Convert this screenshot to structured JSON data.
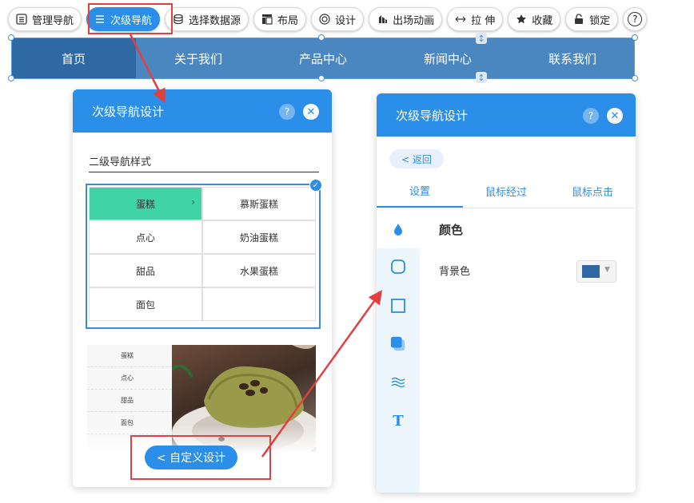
{
  "toolbar": {
    "items": [
      {
        "label": "管理导航",
        "icon": "list-icon"
      },
      {
        "label": "次级导航",
        "icon": "menu-icon"
      },
      {
        "label": "选择数据源",
        "icon": "database-icon"
      },
      {
        "label": "布局",
        "icon": "layout-icon"
      },
      {
        "label": "设计",
        "icon": "palette-icon"
      },
      {
        "label": "出场动画",
        "icon": "animation-icon"
      },
      {
        "label": "拉 伸",
        "icon": "stretch-icon"
      },
      {
        "label": "收藏",
        "icon": "star-icon"
      },
      {
        "label": "锁定",
        "icon": "lock-icon"
      }
    ],
    "help_label": "?"
  },
  "navbar": {
    "items": [
      "首页",
      "关于我们",
      "产品中心",
      "新闻中心",
      "联系我们"
    ]
  },
  "left_panel": {
    "title": "次级导航设计",
    "help_label": "?",
    "close_label": "✕",
    "style_label": "二级导航样式",
    "grid": [
      "蛋糕",
      "慕斯蛋糕",
      "点心",
      "奶油蛋糕",
      "甜品",
      "水果蛋糕",
      "面包",
      ""
    ],
    "chevron": "›",
    "checkmark": "✓",
    "preview_items": [
      "蛋糕",
      "点心",
      "甜品",
      "面包"
    ],
    "custom_button": "< 自定义设计"
  },
  "right_panel": {
    "title": "次级导航设计",
    "help_label": "?",
    "close_label": "✕",
    "back_label": "< 返回",
    "tabs": [
      "设置",
      "鼠标经过",
      "鼠标点击"
    ],
    "section_title": "颜色",
    "field_label": "背景色",
    "bg_color": "#2e69a3",
    "caret": "▼",
    "side_icons": [
      "drop-icon",
      "border-radius-icon",
      "border-icon",
      "shadow-icon",
      "wave-icon",
      "text-icon"
    ],
    "text_icon_glyph": "T"
  },
  "colors": {
    "accent": "#2b8ee8",
    "navbar": "#4a86c0",
    "highlight": "#3fd3a6",
    "annotation": "#e24040"
  }
}
